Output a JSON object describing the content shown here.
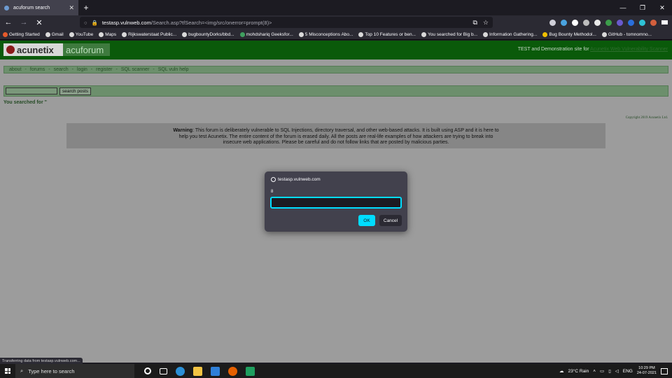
{
  "browser": {
    "tab_title": "acuforum search",
    "url_host": "testasp.vulnweb.com",
    "url_rest": "/Search.asp?tfSearch=<img/src/onerror=prompt(8)>",
    "status_text": "Transferring data from testasp.vulnweb.com..."
  },
  "bookmarks": [
    "Getting Started",
    "Gmail",
    "YouTube",
    "Maps",
    "Rijkswaterstaat Public...",
    "bugbountyDorks/bbd...",
    "mohdshariq Geeksfor...",
    "5 Misconceptions Abo...",
    "Top 10 Features or ben...",
    "You searched for Big b...",
    "Information Gathering...",
    "Bug Bounty Methodol...",
    "GitHub - tomnomno..."
  ],
  "site": {
    "logo_left": "acunetix",
    "logo_right": "acuforum",
    "tagline_prefix": "TEST and Demonstration site for",
    "tagline_link": "Acunetix Web Vulnerability Scanner",
    "menu": [
      "about",
      "forums",
      "search",
      "login",
      "register",
      "SQL scanner",
      "SQL vuln help"
    ],
    "search_button": "search posts",
    "searched_text": "You searched for ''",
    "copyright": "Copyright 2019 Acunetix Ltd.",
    "warning_label": "Warning",
    "warning_text": ": This forum is deliberately vulnerable to SQL Injections, directory traversal, and other web-based attacks. It is built using ASP and it is here to help you test Acunetix. The entire content of the forum is erased daily. All the posts are real-life examples of how attackers are trying to break into insecure web applications. Please be careful and do not follow links that are posted by malicious parties."
  },
  "dialog": {
    "host": "testasp.vulnweb.com",
    "message": "8",
    "input_value": "",
    "ok_label": "OK",
    "cancel_label": "Cancel"
  },
  "taskbar": {
    "search_placeholder": "Type here to search",
    "weather": "23°C  Rain",
    "lang": "ENG",
    "time": "10:29 PM",
    "date": "24-07-2021"
  }
}
